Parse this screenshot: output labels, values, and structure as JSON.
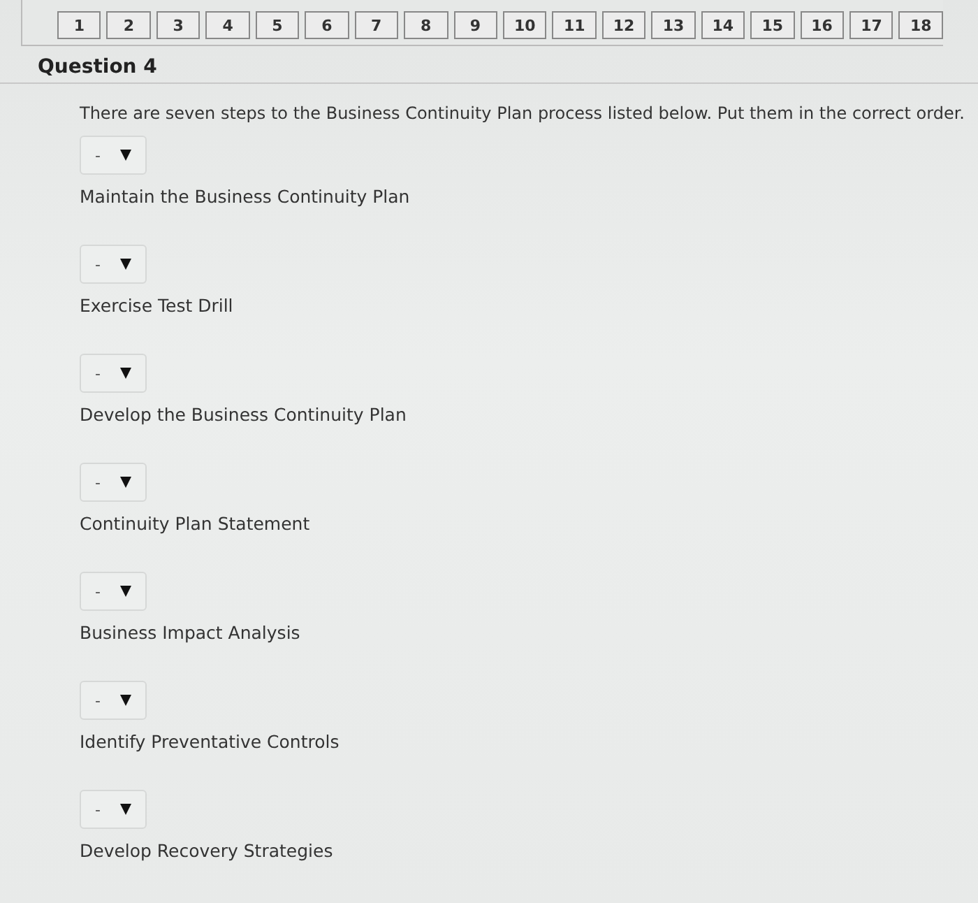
{
  "question_nav": [
    {
      "label": "1"
    },
    {
      "label": "2"
    },
    {
      "label": "3"
    },
    {
      "label": "4"
    },
    {
      "label": "5"
    },
    {
      "label": "6"
    },
    {
      "label": "7"
    },
    {
      "label": "8"
    },
    {
      "label": "9"
    },
    {
      "label": "10"
    },
    {
      "label": "11"
    },
    {
      "label": "12"
    },
    {
      "label": "13"
    },
    {
      "label": "14"
    },
    {
      "label": "15"
    },
    {
      "label": "16"
    },
    {
      "label": "17"
    },
    {
      "label": "18"
    }
  ],
  "question": {
    "title": "Question 4",
    "prompt": "There are seven steps to the Business Continuity Plan process listed below. Put them in the correct order."
  },
  "steps": [
    {
      "value": "-",
      "label": "Maintain the Business Continuity Plan"
    },
    {
      "value": "-",
      "label": "Exercise Test Drill"
    },
    {
      "value": "-",
      "label": "Develop the Business Continuity Plan"
    },
    {
      "value": "-",
      "label": "Continuity Plan Statement"
    },
    {
      "value": "-",
      "label": "Business Impact Analysis"
    },
    {
      "value": "-",
      "label": "Identify Preventative Controls"
    },
    {
      "value": "-",
      "label": "Develop Recovery Strategies"
    }
  ]
}
